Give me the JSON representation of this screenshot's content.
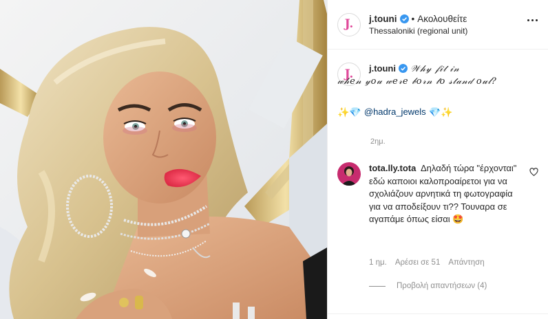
{
  "post": {
    "username": "j.touni",
    "follow_separator": "•",
    "follow_label": "Ακολουθείτε",
    "location": "Thessaloniki (regional unit)",
    "avatar_letter": "J.",
    "brand_color": "#e0489a",
    "verified_color": "#3897f0"
  },
  "caption": {
    "username": "j.touni",
    "quote_line1": "𝒲𝒽𝓎 𝒻𝒾𝓉 𝒾𝓃",
    "quote_line2": "𝓌𝒽𝑒𝓃 𝓎𝑜𝓊 𝓌𝑒𝓇𝑒 𝒷𝑜𝓇𝓃 𝓉𝑜 𝓈𝓉𝒶𝓃𝒹 𝑜𝓊𝓉?",
    "emoji_left": "✨💎",
    "mention": "@hadra_jewels",
    "emoji_right": "💎✨",
    "time": "2ημ."
  },
  "comment": {
    "username": "tota.lly.tota",
    "text": "Δηλαδή τώρα \"έρχονται\" εδώ καποιοι καλοπροαίρετοι για να σχολιάζουν αρνητικά τη φωτογραφία για να αποδείξουν τι?? Τουναρα σε αγαπάμε όπως είσαι 🤩",
    "time": "1 ημ.",
    "likes": "Αρέσει σε 51",
    "reply": "Απάντηση",
    "view_replies": "Προβολή απαντήσεων (4)"
  },
  "icons": {
    "verified": "verified-badge-icon",
    "more": "more-options-icon",
    "heart": "heart-outline-icon"
  }
}
